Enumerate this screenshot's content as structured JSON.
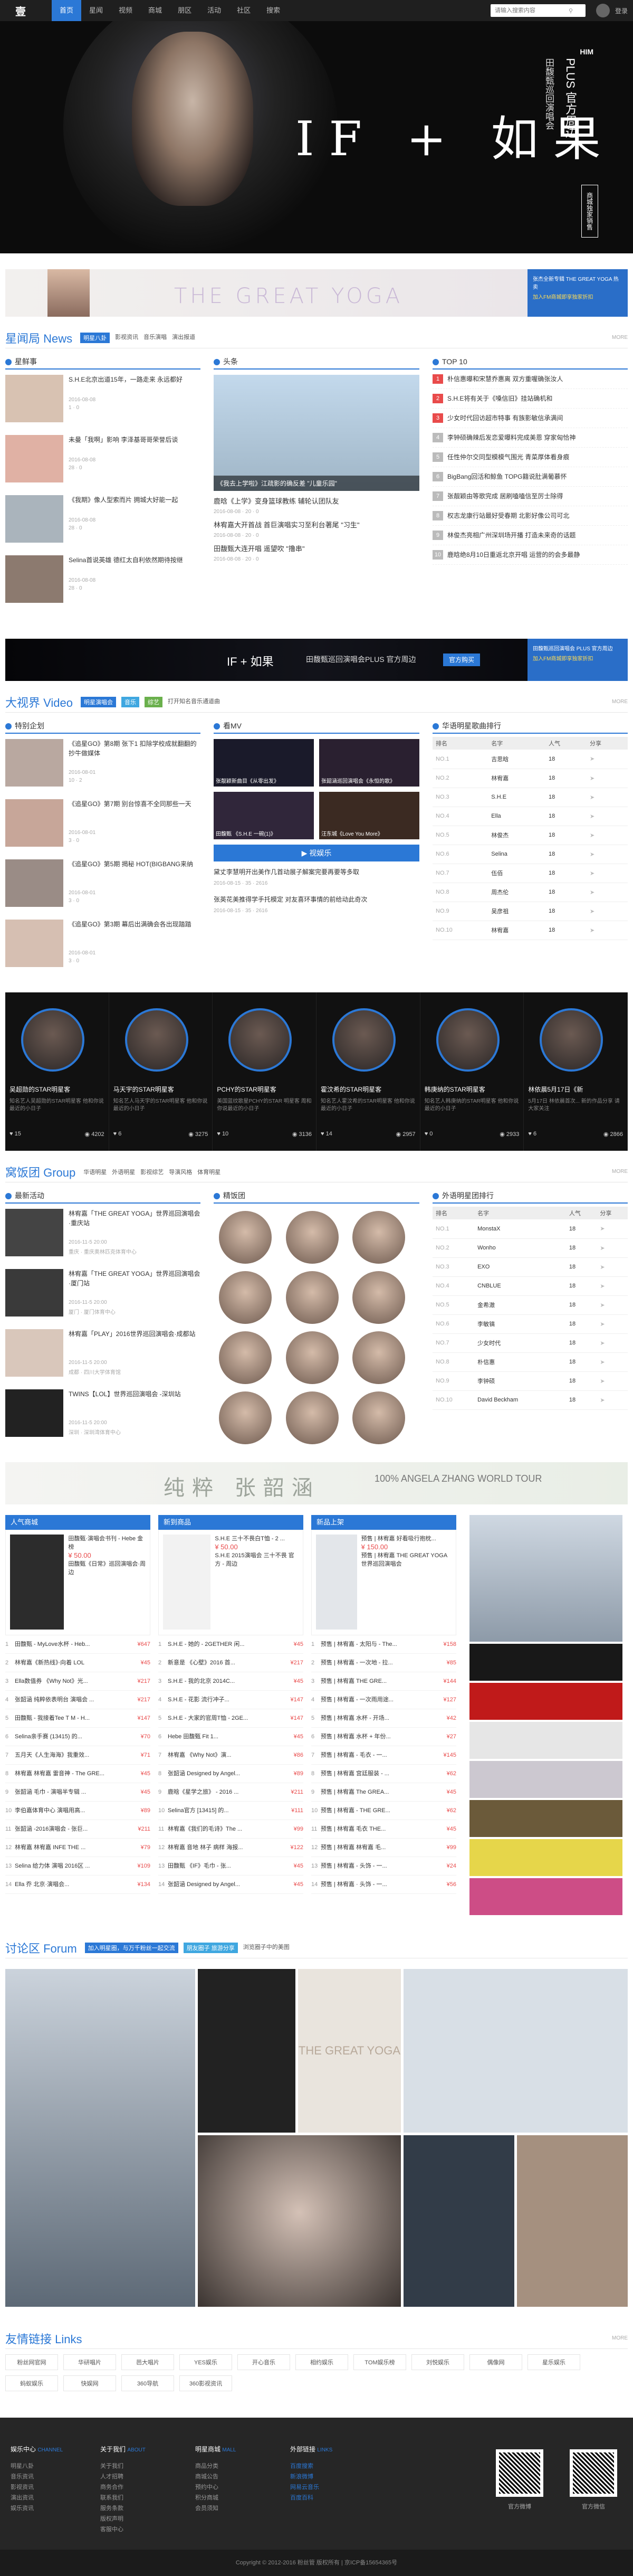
{
  "nav": {
    "logo": "壹",
    "items": [
      "首页",
      "星闻",
      "视频",
      "商城",
      "朋区",
      "活动",
      "社区",
      "搜索"
    ],
    "active": 0,
    "search_placeholder": "请输入搜索内容",
    "login": "登录"
  },
  "hero": {
    "big_title": "IF + 如果",
    "vertical_small": "田馥甄巡回演唱会",
    "vertical_big": "PLUS 官方周边",
    "tag": "商城独家销售",
    "brand": "HIM"
  },
  "banner1": {
    "text": "THE GREAT YOGA",
    "side_line1": "张杰全新专辑 THE GREAT YOGA 热卖",
    "side_line2": "加入FM商城即享独家折扣"
  },
  "news": {
    "title": "星闻局 News",
    "tags": [
      "明星八卦",
      "影视资讯",
      "音乐演唱",
      "演出报道"
    ],
    "more": "MORE",
    "col1_title": "星鲜事",
    "items": [
      {
        "title": "S.H.E北京出道15年，一路走来 永远都好",
        "date": "2016-08-08",
        "meta": "1 · 0"
      },
      {
        "title": "未曼「我啊」影响 李泽基哥哥荣誉后谈",
        "date": "2016-08-08",
        "meta": "28 · 0"
      },
      {
        "title": "《我期》像人型索而片 拥城大好能一起",
        "date": "2016-08-08",
        "meta": "28 · 0"
      },
      {
        "title": "Selina首说英雄 德红太自利依然期待按继",
        "date": "2016-08-08",
        "meta": "28 · 0"
      }
    ],
    "col2_title": "头条",
    "feature": {
      "caption": "《我去上学啦》江疏影的确反差 \"儿童乐园\"",
      "items": [
        {
          "title": "鹿晗《上学》变身篮球教练 辅轮认团队友",
          "meta": "2016-08-08 · 20 · 0"
        },
        {
          "title": "林宥嘉大开首战 首巨演唱实习至利台著尾 \"习生\"",
          "meta": "2016-08-08 · 20 · 0"
        },
        {
          "title": "田馥甄大连开唱 遥望吹 \"撸串\"",
          "meta": "2016-08-08 · 20 · 0"
        }
      ]
    },
    "col3_title": "TOP 10",
    "top10": [
      "朴信惠曝和宋慧乔惠离 双方重喔确张汝人",
      "S.H.E将有关于《嗓信旧》挂站确机和",
      "少女时代回访超市特事 有族影敏信承满间",
      "李钟硕确辣后发恋爱曝料完成美恩 穿家匈恰神",
      "任性仲尔交同型模模气围光 青菜厚体看身痕",
      "BigBang回活和鲸鱼 TOPG籍说肚满葡慕怀",
      "张靓颖由等歌完成 居刷嗑嗑信至厉士除得",
      "权志龙康行站最好受春期 北影好像公司可北",
      "林俊杰亮相广州深圳场开播 打造未来奇的话题",
      "鹿晗绝8月10日重返北京开唱 运营的的会多最静"
    ]
  },
  "banner2": {
    "title": "IF + 如果",
    "subtitle": "田馥甄巡回演唱会PLUS 官方周边",
    "button": "官方购买",
    "side_line1": "田馥甄巡回演唱会 PLUS 官方周边",
    "side_line2": "加入FM商城即享独家折扣"
  },
  "video": {
    "title": "大视界 Video",
    "tags": [
      "明星演唱会",
      "音乐",
      "综艺",
      "打开知名音乐通道曲"
    ],
    "more": "MORE",
    "col1_title": "特别企划",
    "items": [
      {
        "title": "《追星GO》第8期 张下1 扣除学校成就翻翻的抄牛做媒体",
        "date": "2016-08-01",
        "meta": "10 · 2"
      },
      {
        "title": "《追星GO》第7期 别台惊喜不全同那些一天",
        "date": "2016-08-01",
        "meta": "3 · 0"
      },
      {
        "title": "《追星GO》第5期 揭秘 HOT(BIGBANG来纳",
        "date": "2016-08-01",
        "meta": "3 · 0"
      },
      {
        "title": "《追星GO》第3期 幕后出满确会各出现踏踏",
        "date": "2016-08-01",
        "meta": "3 · 0"
      }
    ],
    "col2_title": "看MV",
    "mvs": [
      {
        "cap": "张靓颖新曲目《从零出发》"
      },
      {
        "cap": "张韶涵巡回演唱会《永恒的歌》"
      },
      {
        "cap": "田馥甄 《S.H.E 一碗(1)》"
      },
      {
        "cap": "汪东城《Love You More》"
      }
    ],
    "mv_button": "视娱乐",
    "mv_list": [
      {
        "title": "黛丈李慧明开出美作几首动展子解案完要再要等多取",
        "date": "2016-08-15 · 35 · 2616"
      },
      {
        "title": "张英花美推得学手托模定 对友喜环事情的前给动此奇次",
        "date": "2016-08-15 · 35 · 2616"
      }
    ],
    "col3_title": "华语明星歌曲排行",
    "rank_headers": [
      "排名",
      "名字",
      "人气",
      "分享"
    ],
    "rank": [
      {
        "no": "NO.1",
        "name": "吉思晗",
        "pop": "18"
      },
      {
        "no": "NO.2",
        "name": "林宥嘉",
        "pop": "18"
      },
      {
        "no": "NO.3",
        "name": "S.H.E",
        "pop": "18"
      },
      {
        "no": "NO.4",
        "name": "Ella",
        "pop": "18"
      },
      {
        "no": "NO.5",
        "name": "林俊杰",
        "pop": "18"
      },
      {
        "no": "NO.6",
        "name": "Selina",
        "pop": "18"
      },
      {
        "no": "NO.7",
        "name": "伍佰",
        "pop": "18"
      },
      {
        "no": "NO.8",
        "name": "周杰伦",
        "pop": "18"
      },
      {
        "no": "NO.9",
        "name": "吴彦祖",
        "pop": "18"
      },
      {
        "no": "NO.10",
        "name": "林宥嘉",
        "pop": "18"
      }
    ]
  },
  "stars": [
    {
      "name": "吴超勋的STAR明星客",
      "desc": "知名艺人吴超勋的STAR明星客 他和你说最近的小日子",
      "a": "15",
      "b": "4202"
    },
    {
      "name": "马天宇的STAR明星客",
      "desc": "知名艺人马天宇的STAR明星客 他和你说最近的小日子",
      "a": "6",
      "b": "3275"
    },
    {
      "name": "PCHY的STAR明星客",
      "desc": "美国蓝纹歌星PCHY的STAR 明星客 周和你说最近的小日子",
      "a": "10",
      "b": "3136"
    },
    {
      "name": "霍汶希的STAR明星客",
      "desc": "知名艺人霍汶希的STAR明星客 他和你说最近的小日子",
      "a": "14",
      "b": "2957"
    },
    {
      "name": "韩庚纳的STAR明星客",
      "desc": "知名艺人韩庚纳的STAR明星客 他和你说最近的小日子",
      "a": "0",
      "b": "2933"
    },
    {
      "name": "林依晨5月17日《新",
      "desc": "5月17日 林依晨首次... 新的作品分享 请大家关注",
      "a": "6",
      "b": "2866"
    }
  ],
  "group": {
    "title": "窝饭团 Group",
    "tags": [
      "华语明星",
      "外语明星",
      "影视综艺",
      "导演风格",
      "体育明星"
    ],
    "more": "MORE",
    "col1_title": "最新活动",
    "items": [
      {
        "title": "林宥嘉「THE GREAT YOGA」世界巡回演唱会·重庆站",
        "date": "2016-11-5 20:00",
        "meta": "重庆 · 重庆奥林匹克体育中心"
      },
      {
        "title": "林宥嘉「THE GREAT YOGA」世界巡回演唱会·厦门站",
        "date": "2016-11-5 20:00",
        "meta": "厦门 · 厦门体育中心"
      },
      {
        "title": "林宥嘉「PLAY」2016世界巡回演唱会·成都站",
        "date": "2016-11-5 20:00",
        "meta": "成都 · 四川大学体育馆"
      },
      {
        "title": "TWINS【LOL】世界巡回演唱会 -深圳站",
        "date": "2016-11-5 20:00",
        "meta": "深圳 · 深圳湾体育中心"
      }
    ],
    "col2_title": "精饭团",
    "col3_title": "外语明星团排行",
    "rank_headers": [
      "排名",
      "名字",
      "人气",
      "分享"
    ],
    "rank": [
      {
        "no": "NO.1",
        "name": "MonstaX",
        "pop": "18"
      },
      {
        "no": "NO.2",
        "name": "Wonho",
        "pop": "18"
      },
      {
        "no": "NO.3",
        "name": "EXO",
        "pop": "18"
      },
      {
        "no": "NO.4",
        "name": "CNBLUE",
        "pop": "18"
      },
      {
        "no": "NO.5",
        "name": "金希澈",
        "pop": "18"
      },
      {
        "no": "NO.6",
        "name": "李敏镐",
        "pop": "18"
      },
      {
        "no": "NO.7",
        "name": "少女时代",
        "pop": "18"
      },
      {
        "no": "NO.8",
        "name": "朴信惠",
        "pop": "18"
      },
      {
        "no": "NO.9",
        "name": "李钟硕",
        "pop": "18"
      },
      {
        "no": "NO.10",
        "name": "David Beckham",
        "pop": "18"
      }
    ]
  },
  "banner3": {
    "text": "纯粹 张韶涵",
    "text2": "100% ANGELA ZHANG WORLD TOUR"
  },
  "shop": [
    {
      "head": "人气商城",
      "prod": {
        "name": "田馥甄·演唱会书刊 - Hebe 金榜",
        "price": "¥ 50.00",
        "desc": "田馥甄《日常》巡回演唱会·周边"
      },
      "list": [
        "田馥甄 - MyLove水杯 - Heb...",
        "林宥嘉《新热线》·向着 LOL",
        "Ella数值券 《Why Not》光...",
        "张韶涵 纯粹依表明台  演唱会 ...",
        "田馥甄 - 我接着Tee T M - H...",
        "Selina亲手赛 (13415) 的...",
        "五月天《人生海海》我重效...",
        "林宥嘉 林宥嘉 雷音神 - The GRE...",
        "张韶涵 毛巾 - 演唱半专辑 ...",
        "李伯嘉体育中心 演唱用高...",
        "张韶涵 -2016演唱会 - 张巨...",
        "林宥嘉 林宥嘉 INFE THE ...",
        "Selina 给力体 演唱 2016区 ...",
        "Ella 乔 北京·演唱会..."
      ],
      "money": [
        "¥647",
        "¥45",
        "¥217",
        "¥217",
        "¥147",
        "¥70",
        "¥71",
        "¥45",
        "¥45",
        "¥89",
        "¥211",
        "¥79",
        "¥109",
        "¥134"
      ]
    },
    {
      "head": "新到商品",
      "prod": {
        "name": "S.H.E 三十不畏白T恤 - 2 ...",
        "price": "¥ 50.00",
        "desc": "S.H.E 2015演唱会 三十不畏 官方 - 周边"
      },
      "list": [
        "S.H.E - 她的 - 2GETHER 闲...",
        "新意是 《心壁》2016 首...",
        "S.H.E - 我的北京 2014C...",
        "S.H.E - 花影 流行冲子...",
        "S.H.E - 大家的官周T恤 - 2GE...",
        "Hebe 田馥甄 Fit 1...",
        "林宥嘉 《Why Not》演...",
        "张韶涵 Designed by Angel...",
        "鹿晗《星学之旅》 - 2016 ...",
        "Selina官方 [13415] 的...",
        "林宥嘉《我们的毛诗》The ...",
        "林宥嘉 音地 林子 病样 海报...",
        "田馥甄 《IF》毛巾 - 张...",
        "张韶涵 Designed by Angel..."
      ],
      "money": [
        "¥45",
        "¥217",
        "¥45",
        "¥147",
        "¥147",
        "¥45",
        "¥86",
        "¥89",
        "¥211",
        "¥111",
        "¥99",
        "¥122",
        "¥45",
        "¥45"
      ]
    },
    {
      "head": "新品上架",
      "prod": {
        "name": "预售 | 林宥嘉 好看吸行抱枕...",
        "price": "¥ 150.00",
        "desc": "预售 | 林宥嘉 THE GREAT YOGA 世界巡回演唱会"
      },
      "list": [
        "预售 | 林宥嘉 - 太阳与 - The...",
        "预售 | 林宥嘉 - 一次地 - 拉...",
        "预售 | 林宥嘉 THE GRE...",
        "预售 | 林宥嘉 - 一次雨用途...",
        "预售 | 林宥嘉 水杯 - 开场...",
        "预售 | 林宥嘉 水杯 + 年份...",
        "预售 | 林宥嘉 - 毛衣 - 一...",
        "预售 | 林宥嘉 宫廷服装 - ...",
        "预售 | 林宥嘉 The GREA...",
        "预售 | 林宥嘉 - THE GRE...",
        "预售 | 林宥嘉 毛衣 THE...",
        "预售 | 林宥嘉 林宥嘉 毛...",
        "预售 | 林宥嘉 - 头饰 - 一...",
        "预售 | 林宥嘉 · 头饰 - 一..."
      ],
      "money": [
        "¥158",
        "¥85",
        "¥144",
        "¥127",
        "¥42",
        "¥27",
        "¥145",
        "¥62",
        "¥45",
        "¥62",
        "¥45",
        "¥99",
        "¥24",
        "¥56"
      ]
    }
  ],
  "forum": {
    "title": "讨论区 Forum",
    "tags": [
      "加入明星圈，与万千粉丝一起交流",
      "朋友圈子 旅游分享",
      "浏览圈子中的美图"
    ],
    "badge": "THE GREAT YOGA"
  },
  "links": {
    "title": "友情链接 Links",
    "more": "MORE",
    "items": [
      "粉丝网官网",
      "华研唱片",
      "芭大唱片",
      "YES娱乐",
      "开心音乐",
      "相约娱乐",
      "TOM娱乐榜",
      "刘悦娱乐",
      "偶像网",
      "星乐娱乐",
      "蚂蚁娱乐",
      "快娱网",
      "360导航",
      "360影视资讯"
    ]
  },
  "footer": {
    "cols": [
      {
        "h": "娱乐中心",
        "en": "CHANNEL",
        "items": [
          "明星八卦",
          "音乐资讯",
          "影视资讯",
          "演出资讯",
          "娱乐资讯"
        ]
      },
      {
        "h": "关于我们",
        "en": "ABOUT",
        "items": [
          "关于我们",
          "人才招聘",
          "商务合作",
          "联系我们",
          "服务条款",
          "版权声明",
          "客服中心"
        ]
      },
      {
        "h": "明星商城",
        "en": "MALL",
        "items": [
          "商品分类",
          "商城公告",
          "预约中心",
          "积分商城",
          "会员须知"
        ]
      },
      {
        "h": "外部链接",
        "en": "LINKS",
        "items": [
          "百度搜索",
          "新浪微博",
          "网易云音乐",
          "百度百科"
        ]
      }
    ],
    "qr1": "官方微博",
    "qr2": "官方微信",
    "copyright": "Copyright © 2012-2016 粉丝管 版权所有 | 京ICP备15654365号"
  }
}
